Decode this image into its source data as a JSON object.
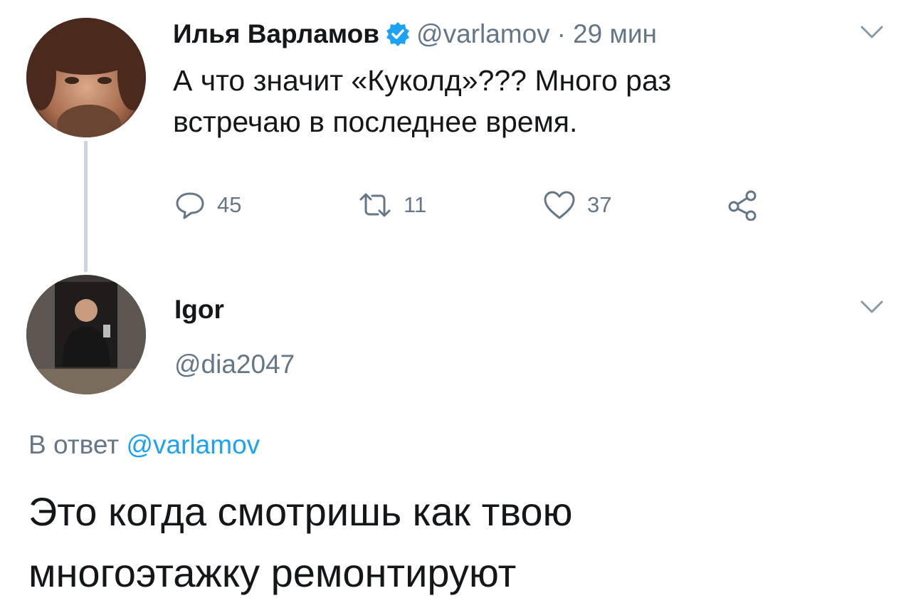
{
  "tweet": {
    "author_name": "Илья Варламов",
    "verified": true,
    "handle": "@varlamov",
    "separator": "·",
    "time": "29 мин",
    "text_line1": "А что значит «Куколд»??? Много раз",
    "text_line2": "встречаю в последнее время.",
    "replies": "45",
    "retweets": "11",
    "likes": "37"
  },
  "reply": {
    "author_name": "Igor",
    "handle": "@dia2047",
    "in_reply_prefix": "В ответ",
    "in_reply_handle": "@varlamov",
    "text_line1": "Это когда смотришь как твою",
    "text_line2": "многоэтажку ремонтируют"
  },
  "colors": {
    "link": "#1da1f2",
    "secondary_text": "#657786",
    "thread_line": "#ccd6dd"
  },
  "icons": {
    "reply": "reply-icon",
    "retweet": "retweet-icon",
    "like": "heart-icon",
    "share": "share-icon",
    "verified": "verified-badge-icon",
    "menu": "chevron-down-icon"
  }
}
